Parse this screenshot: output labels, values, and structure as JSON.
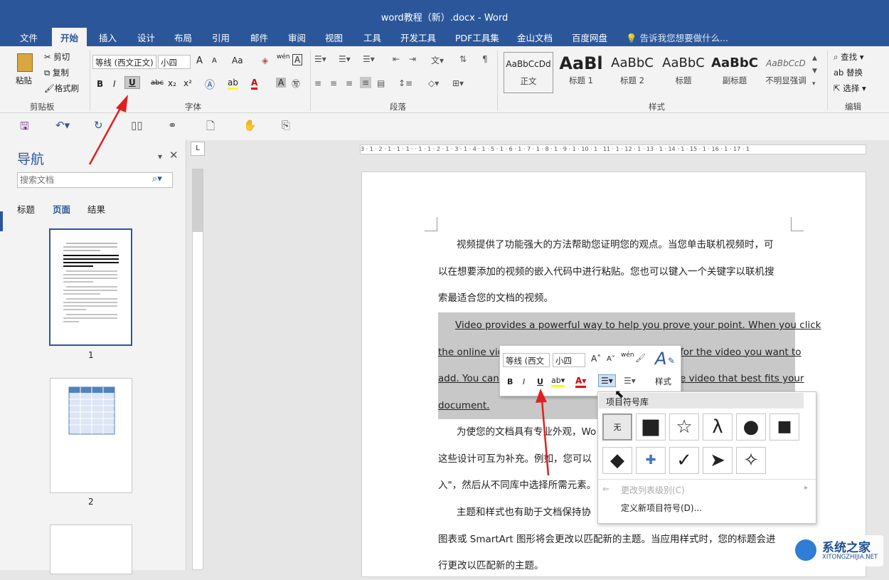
{
  "window": {
    "title": "word教程（新）.docx - Word"
  },
  "tabs": [
    "文件",
    "开始",
    "插入",
    "设计",
    "布局",
    "引用",
    "邮件",
    "审阅",
    "视图",
    "工具",
    "开发工具",
    "PDF工具集",
    "金山文档",
    "百度网盘"
  ],
  "tell_me": "告诉我您想要做什么...",
  "ribbon": {
    "clipboard": {
      "paste": "粘贴",
      "cut": "剪切",
      "copy": "复制",
      "format_painter": "格式刷",
      "group": "剪贴板"
    },
    "font": {
      "name": "等线 (西文正文)",
      "size": "小四",
      "group": "字体",
      "bold": "B",
      "italic": "I",
      "underline": "U",
      "strike": "abc",
      "sub": "x₂",
      "sup": "x²",
      "grow": "A",
      "shrink": "A",
      "case": "Aa",
      "wen": "wén",
      "char_border": "A"
    },
    "paragraph": {
      "group": "段落"
    },
    "styles": {
      "group": "样式",
      "items": [
        {
          "preview": "AaBbCcDd",
          "name": "正文"
        },
        {
          "preview": "AaBl",
          "name": "标题 1"
        },
        {
          "preview": "AaBbC",
          "name": "标题 2"
        },
        {
          "preview": "AaBbC",
          "name": "标题"
        },
        {
          "preview": "AaBbC",
          "name": "副标题"
        },
        {
          "preview": "AaBbCcD",
          "name": "不明显强调"
        }
      ]
    },
    "editing": {
      "group": "编辑",
      "find": "查找",
      "replace": "替换",
      "select": "选择"
    }
  },
  "nav": {
    "title": "导航",
    "search_placeholder": "搜索文档",
    "tabs": [
      "标题",
      "页面",
      "结果"
    ],
    "active_tab": "页面",
    "pages": [
      "1",
      "2"
    ]
  },
  "ruler": {
    "h": "3 · 1 · 2 · 1 · 1 · 1 ·   · 1 · 1 · 2 · 1 · 3 · 1 · 4 · 1 · 5 · 1 · 6 · 1 · 7 · 1 · 8 · 1 · 9 · 1 · 10 · 1 · 11 · 1 · 12 · 1 · 13 · 1 · 14 · 1 · 15 · 1 · 16 · 1 · 17 · 1"
  },
  "document": {
    "p1": [
      "视频提供了功能强大的方法帮助您证明您的观点。当您单击联机视频时，可",
      "以在想要添加的视频的嵌入代码中进行粘贴。您也可以键入一个关键字以联机搜",
      "索最适合您的文档的视频。"
    ],
    "p2": [
      "Video provides a powerful way to help you prove your point. When you click",
      "the online vide",
      "for the video you want to",
      "add. You can a",
      "e video that best fits your",
      "document."
    ],
    "p3": [
      "为使您的文档具有专业外观，Wo",
      "这些设计可互为补充。例如，您可以",
      "入\"，然后从不同库中选择所需元素。"
    ],
    "p4": [
      "主题和样式也有助于文档保持协",
      "图表或 SmartArt 图形将会更改以匹配新的主题。当应用样式时，您的标题会进",
      "行更改以匹配新的主题。"
    ]
  },
  "mini_toolbar": {
    "font": "等线 (西文",
    "size": "小四",
    "styles": "样式",
    "wen": "wén"
  },
  "bullet_library": {
    "title": "项目符号库",
    "none": "无",
    "symbols": [
      "■",
      "☆",
      "λ",
      "●",
      "■",
      "◆",
      "✚",
      "✓",
      "➤",
      "✧"
    ],
    "change_level": "更改列表级别(C)",
    "define_new": "定义新项目符号(D)..."
  },
  "watermark": {
    "name": "系统之家",
    "url": "XITONGZHIJIA.NET"
  }
}
